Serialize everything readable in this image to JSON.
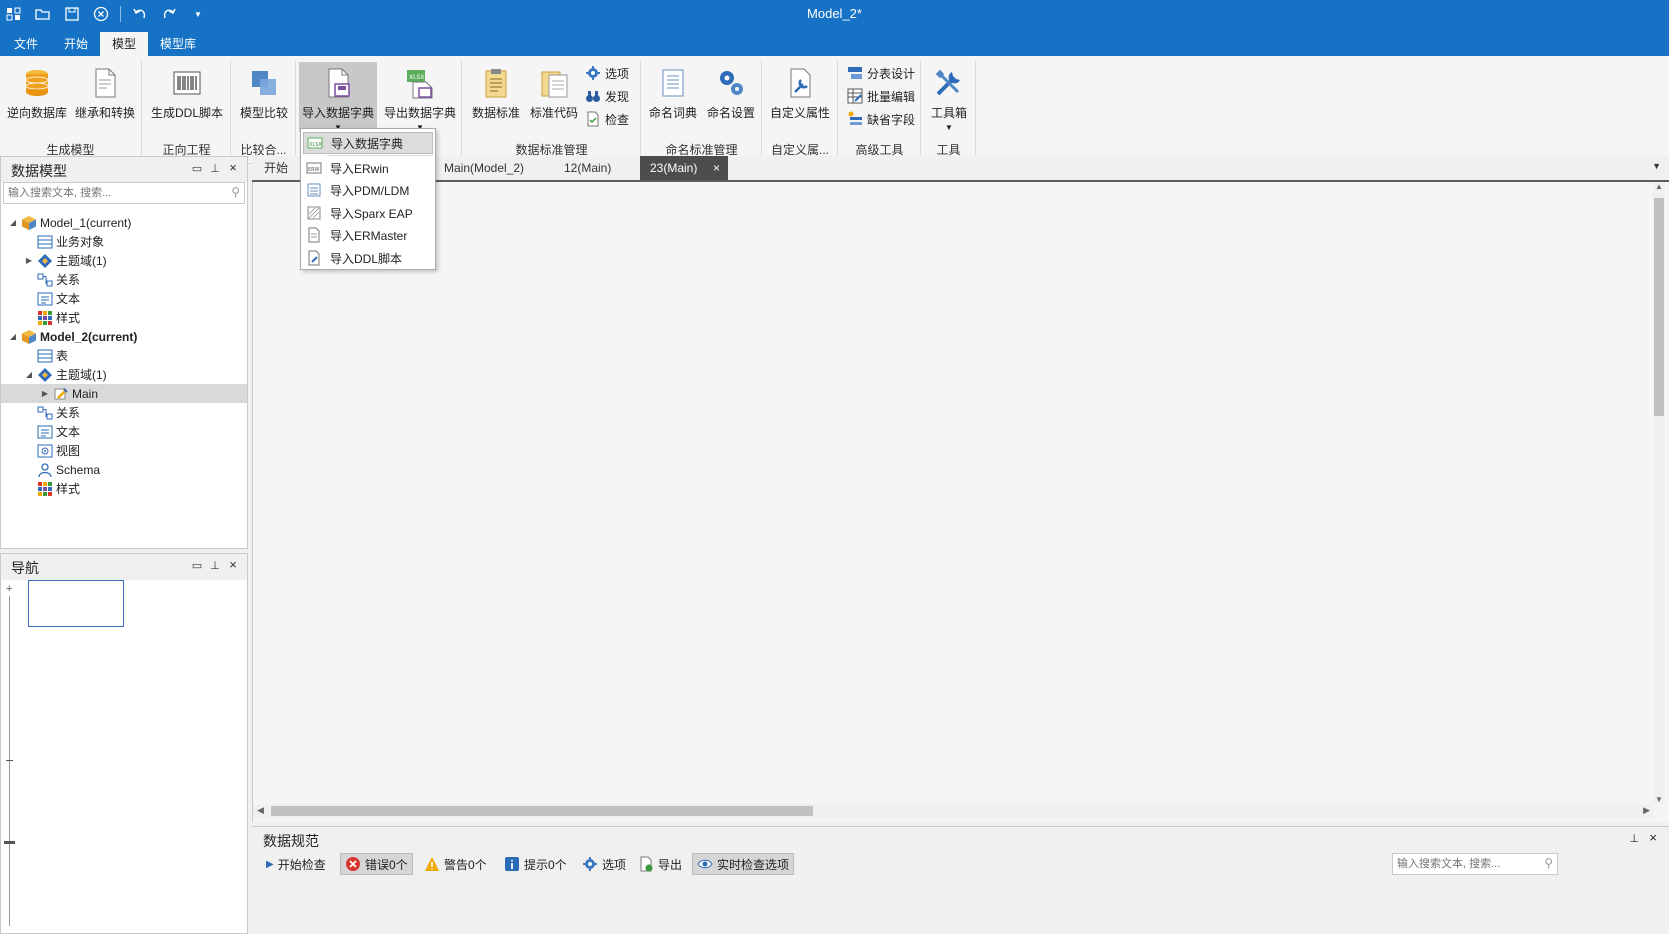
{
  "window": {
    "title": "Model_2*",
    "quick_access": [
      "app-icon",
      "open-icon",
      "save-icon",
      "close-circle-icon",
      "undo-icon",
      "redo-icon",
      "customize-icon"
    ]
  },
  "menu_tabs": [
    {
      "label": "文件"
    },
    {
      "label": "开始"
    },
    {
      "label": "模型",
      "active": true
    },
    {
      "label": "模型库"
    }
  ],
  "ribbon": {
    "groups": [
      {
        "label": "生成模型",
        "buttons": [
          {
            "label": "逆向数据库"
          },
          {
            "label": "继承和转换"
          }
        ]
      },
      {
        "label": "正向工程",
        "buttons": [
          {
            "label": "生成DDL脚本"
          }
        ]
      },
      {
        "label": "比较合...",
        "buttons": [
          {
            "label": "模型比较"
          }
        ]
      },
      {
        "label": "",
        "buttons": [
          {
            "label": "导入数据字典"
          },
          {
            "label": "导出数据字典"
          }
        ]
      },
      {
        "label": "数据标准管理",
        "buttons": [
          {
            "label": "数据标准"
          },
          {
            "label": "标准代码"
          }
        ],
        "small": [
          {
            "label": "选项"
          },
          {
            "label": "发现"
          },
          {
            "label": "检查"
          }
        ]
      },
      {
        "label": "命名标准管理",
        "buttons": [
          {
            "label": "命名词典"
          },
          {
            "label": "命名设置"
          }
        ]
      },
      {
        "label": "自定义属...",
        "buttons": [
          {
            "label": "自定义属性"
          }
        ]
      },
      {
        "label": "高级工具",
        "small": [
          {
            "label": "分表设计"
          },
          {
            "label": "批量编辑"
          },
          {
            "label": "缺省字段"
          }
        ]
      },
      {
        "label": "工具",
        "buttons": [
          {
            "label": "工具箱"
          }
        ]
      }
    ]
  },
  "dropdown": {
    "items": [
      {
        "label": "导入数据字典"
      },
      {
        "label": "导入ERwin"
      },
      {
        "label": "导入PDM/LDM"
      },
      {
        "label": "导入Sparx EAP"
      },
      {
        "label": "导入ERMaster"
      },
      {
        "label": "导入DDL脚本"
      }
    ]
  },
  "data_model_panel": {
    "title": "数据模型",
    "search_placeholder": "输入搜索文本, 搜索...",
    "tree": [
      {
        "label": "Model_1(current)",
        "icon": "model-cube-icon"
      },
      {
        "label": "业务对象",
        "icon": "table-icon"
      },
      {
        "label": "主题域(1)",
        "icon": "subject-area-icon"
      },
      {
        "label": "关系",
        "icon": "relation-icon"
      },
      {
        "label": "文本",
        "icon": "text-icon"
      },
      {
        "label": "样式",
        "icon": "style-icon"
      },
      {
        "label": "Model_2(current)",
        "icon": "model-cube-icon"
      },
      {
        "label": "表",
        "icon": "table-icon"
      },
      {
        "label": "主题域(1)",
        "icon": "subject-area-icon"
      },
      {
        "label": "Main",
        "icon": "diagram-icon"
      },
      {
        "label": "关系",
        "icon": "relation-icon"
      },
      {
        "label": "文本",
        "icon": "text-icon"
      },
      {
        "label": "视图",
        "icon": "view-icon"
      },
      {
        "label": "Schema",
        "icon": "schema-icon"
      },
      {
        "label": "样式",
        "icon": "style-icon"
      }
    ]
  },
  "nav_panel": {
    "title": "导航"
  },
  "doc_tabs": [
    {
      "label": "开始"
    },
    {
      "label": "Main(Model_2)"
    },
    {
      "label": "12(Main)"
    },
    {
      "label": "23(Main)",
      "active": true
    }
  ],
  "bottom_panel": {
    "title": "数据规范",
    "buttons": [
      {
        "label": "开始检查"
      },
      {
        "label": "错误0个"
      },
      {
        "label": "警告0个"
      },
      {
        "label": "提示0个"
      },
      {
        "label": "选项"
      },
      {
        "label": "导出"
      },
      {
        "label": "实时检查选项"
      }
    ],
    "search_placeholder": "输入搜索文本, 搜索..."
  },
  "colors": {
    "titlebar": "#1572c4",
    "active_doc_tab": "#4d4d4d",
    "error": "#d9342b",
    "warning": "#f0a800",
    "info": "#2b6cb8"
  }
}
